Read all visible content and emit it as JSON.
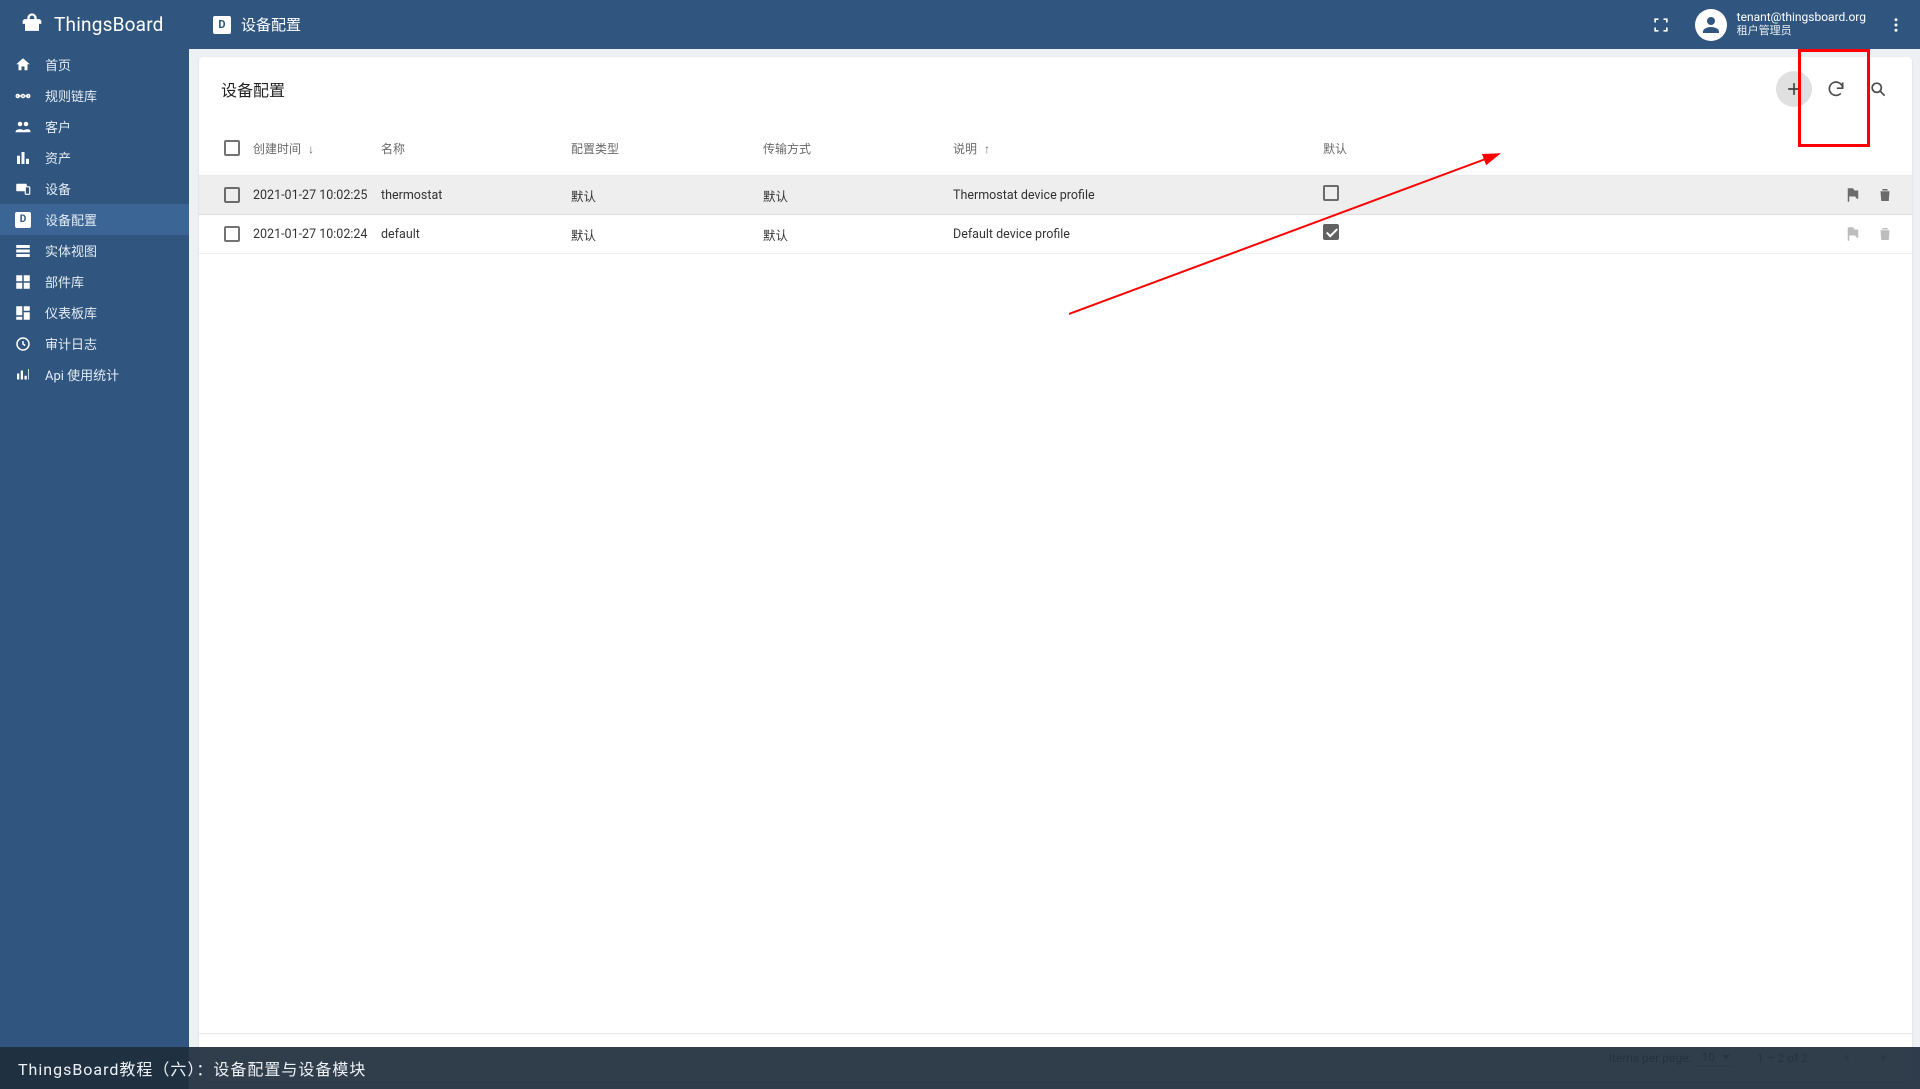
{
  "header": {
    "logo_text": "ThingsBoard",
    "breadcrumb_icon_letter": "D",
    "breadcrumb": "设备配置",
    "user_email": "tenant@thingsboard.org",
    "user_role": "租户管理员"
  },
  "sidebar": {
    "items": [
      {
        "label": "首页",
        "icon": "home"
      },
      {
        "label": "规则链库",
        "icon": "rulechain"
      },
      {
        "label": "客户",
        "icon": "customers"
      },
      {
        "label": "资产",
        "icon": "assets"
      },
      {
        "label": "设备",
        "icon": "devices"
      },
      {
        "label": "设备配置",
        "icon": "devprof",
        "active": true
      },
      {
        "label": "实体视图",
        "icon": "entityview"
      },
      {
        "label": "部件库",
        "icon": "widgets"
      },
      {
        "label": "仪表板库",
        "icon": "dashboards"
      },
      {
        "label": "审计日志",
        "icon": "audit"
      },
      {
        "label": "Api 使用统计",
        "icon": "api"
      }
    ]
  },
  "card": {
    "title": "设备配置",
    "columns": {
      "created": "创建时间",
      "name": "名称",
      "type": "配置类型",
      "transport": "传输方式",
      "description": "说明",
      "default": "默认"
    },
    "rows": [
      {
        "created": "2021-01-27 10:02:25",
        "name": "thermostat",
        "type": "默认",
        "transport": "默认",
        "description": "Thermostat device profile",
        "is_default": false,
        "hovered": true
      },
      {
        "created": "2021-01-27 10:02:24",
        "name": "default",
        "type": "默认",
        "transport": "默认",
        "description": "Default device profile",
        "is_default": true,
        "hovered": false
      }
    ],
    "pagination": {
      "items_per_page_label": "Items per page:",
      "items_per_page_value": "10",
      "range": "1 – 2 of 2"
    }
  },
  "footer": {
    "caption": "ThingsBoard教程（六）：设备配置与设备模块"
  }
}
